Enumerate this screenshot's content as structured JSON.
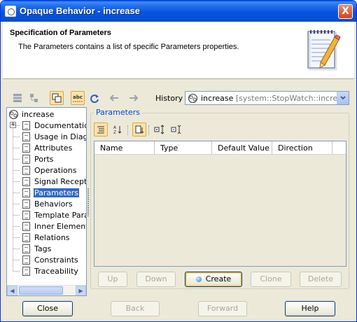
{
  "window": {
    "title": "Opaque Behavior - increase",
    "close_glyph": "X"
  },
  "header": {
    "title": "Specification of Parameters",
    "description": "The Parameters contains a list of specific Parameters properties.",
    "icon": "notepad-pencil-icon"
  },
  "toolbar": {
    "history_label": "History :",
    "history_value": "increase",
    "history_context": " [system::StopWatch::incre..."
  },
  "tree": {
    "root": "increase",
    "items": [
      {
        "label": "Documentation"
      },
      {
        "label": "Usage in Diagra"
      },
      {
        "label": "Attributes"
      },
      {
        "label": "Ports"
      },
      {
        "label": "Operations"
      },
      {
        "label": "Signal Receptio"
      },
      {
        "label": "Parameters",
        "selected": true
      },
      {
        "label": "Behaviors"
      },
      {
        "label": "Template Param"
      },
      {
        "label": "Inner Elements"
      },
      {
        "label": "Relations"
      },
      {
        "label": "Tags"
      },
      {
        "label": "Constraints"
      },
      {
        "label": "Traceability"
      }
    ]
  },
  "parameters": {
    "group_title": "Parameters",
    "columns": [
      "Name",
      "Type",
      "Default Value",
      "Direction"
    ],
    "rows": [],
    "buttons": {
      "up": "Up",
      "down": "Down",
      "create": "Create",
      "clone": "Clone",
      "delete": "Delete"
    }
  },
  "footer": {
    "close": "Close",
    "back": "Back",
    "forward": "Forward",
    "help": "Help"
  },
  "colors": {
    "titlebar": "#0655dc",
    "selection": "#316ac5",
    "group_title": "#0046d5",
    "active_tool": "#fde3a8"
  }
}
